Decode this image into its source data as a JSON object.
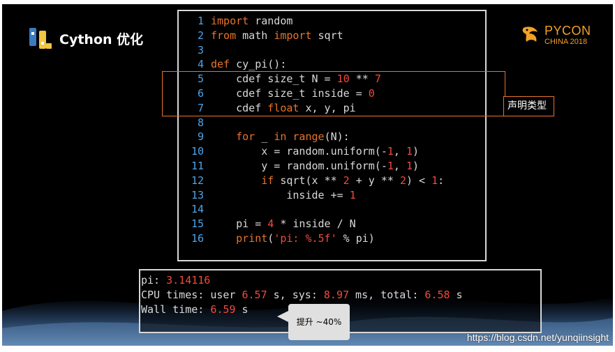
{
  "slide": {
    "title": "Cython 优化",
    "badge_name": "PYCON",
    "badge_sub": "CHINA 2018"
  },
  "code": {
    "lines": [
      {
        "n": "1",
        "parts": [
          {
            "t": "import",
            "c": "kw"
          },
          {
            "t": " random",
            "c": ""
          }
        ]
      },
      {
        "n": "2",
        "parts": [
          {
            "t": "from",
            "c": "kw"
          },
          {
            "t": " math ",
            "c": ""
          },
          {
            "t": "import",
            "c": "kw"
          },
          {
            "t": " sqrt",
            "c": ""
          }
        ]
      },
      {
        "n": "3",
        "parts": []
      },
      {
        "n": "4",
        "parts": [
          {
            "t": "def",
            "c": "kw"
          },
          {
            "t": " cy_pi():",
            "c": ""
          }
        ]
      },
      {
        "n": "5",
        "parts": [
          {
            "t": "    cdef size_t N = ",
            "c": ""
          },
          {
            "t": "10",
            "c": "num"
          },
          {
            "t": " ** ",
            "c": ""
          },
          {
            "t": "7",
            "c": "num"
          }
        ]
      },
      {
        "n": "6",
        "parts": [
          {
            "t": "    cdef size_t inside = ",
            "c": ""
          },
          {
            "t": "0",
            "c": "num"
          }
        ]
      },
      {
        "n": "7",
        "parts": [
          {
            "t": "    cdef ",
            "c": ""
          },
          {
            "t": "float",
            "c": "bi"
          },
          {
            "t": " x, y, pi",
            "c": ""
          }
        ]
      },
      {
        "n": "8",
        "parts": []
      },
      {
        "n": "9",
        "parts": [
          {
            "t": "    ",
            "c": ""
          },
          {
            "t": "for",
            "c": "kw"
          },
          {
            "t": " _ ",
            "c": ""
          },
          {
            "t": "in",
            "c": "kw"
          },
          {
            "t": " ",
            "c": ""
          },
          {
            "t": "range",
            "c": "bi"
          },
          {
            "t": "(N):",
            "c": ""
          }
        ]
      },
      {
        "n": "10",
        "parts": [
          {
            "t": "        x = random.uniform(-",
            "c": ""
          },
          {
            "t": "1",
            "c": "num"
          },
          {
            "t": ", ",
            "c": ""
          },
          {
            "t": "1",
            "c": "num"
          },
          {
            "t": ")",
            "c": ""
          }
        ]
      },
      {
        "n": "11",
        "parts": [
          {
            "t": "        y = random.uniform(-",
            "c": ""
          },
          {
            "t": "1",
            "c": "num"
          },
          {
            "t": ", ",
            "c": ""
          },
          {
            "t": "1",
            "c": "num"
          },
          {
            "t": ")",
            "c": ""
          }
        ]
      },
      {
        "n": "12",
        "parts": [
          {
            "t": "        ",
            "c": ""
          },
          {
            "t": "if",
            "c": "kw"
          },
          {
            "t": " sqrt(x ** ",
            "c": ""
          },
          {
            "t": "2",
            "c": "num"
          },
          {
            "t": " + y ** ",
            "c": ""
          },
          {
            "t": "2",
            "c": "num"
          },
          {
            "t": ") < ",
            "c": ""
          },
          {
            "t": "1",
            "c": "num"
          },
          {
            "t": ":",
            "c": ""
          }
        ]
      },
      {
        "n": "13",
        "parts": [
          {
            "t": "            inside += ",
            "c": ""
          },
          {
            "t": "1",
            "c": "num"
          }
        ]
      },
      {
        "n": "14",
        "parts": []
      },
      {
        "n": "15",
        "parts": [
          {
            "t": "    pi = ",
            "c": ""
          },
          {
            "t": "4",
            "c": "num"
          },
          {
            "t": " * inside / N",
            "c": ""
          }
        ]
      },
      {
        "n": "16",
        "parts": [
          {
            "t": "    ",
            "c": ""
          },
          {
            "t": "print",
            "c": "bi"
          },
          {
            "t": "(",
            "c": ""
          },
          {
            "t": "'pi: %.5f'",
            "c": "str"
          },
          {
            "t": " % pi)",
            "c": ""
          }
        ]
      }
    ]
  },
  "annotations": {
    "declare_types": "声明类型",
    "speedup": "提升 ~40%"
  },
  "output": {
    "lines": [
      {
        "parts": [
          {
            "t": "pi: ",
            "c": ""
          },
          {
            "t": "3.14116",
            "c": "val"
          }
        ]
      },
      {
        "parts": [
          {
            "t": "CPU times: user ",
            "c": ""
          },
          {
            "t": "6.57",
            "c": "val"
          },
          {
            "t": " s, sys: ",
            "c": ""
          },
          {
            "t": "8.97",
            "c": "val"
          },
          {
            "t": " ms, total: ",
            "c": ""
          },
          {
            "t": "6.58",
            "c": "val"
          },
          {
            "t": " s",
            "c": ""
          }
        ]
      },
      {
        "parts": [
          {
            "t": "Wall time: ",
            "c": ""
          },
          {
            "t": "6.59",
            "c": "val"
          },
          {
            "t": " s",
            "c": ""
          }
        ]
      }
    ]
  },
  "watermark": "https://blog.csdn.net/yunqiinsight",
  "colors": {
    "keyword": "#e8742a",
    "number": "#f14a3e",
    "line_number": "#4fa3e8",
    "highlight_border": "#e8742a",
    "brand_orange": "#f2a127"
  }
}
